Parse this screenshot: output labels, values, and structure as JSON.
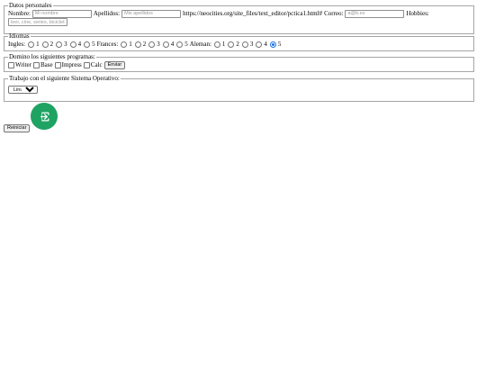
{
  "datos": {
    "legend": "Datos personales",
    "nombre_label": "Nombre:",
    "nombre_placeholder": "Mi nombre",
    "apellidos_label": "Apellidos:",
    "apellidos_placeholder": "Mis apellidos",
    "url_text": "https://neocities.org/site_files/text_editor/pctica1.html#",
    "correo_label": "Correo:",
    "correo_placeholder": "a@b.es",
    "hobbies_label": "Hobbies:",
    "hobbies_placeholder": "leer, cine, series, bicicleta"
  },
  "idiomas": {
    "legend": "Idiomas",
    "groups": [
      {
        "label": "Ingles:",
        "options": [
          "1",
          "2",
          "3",
          "4",
          "5"
        ],
        "selected": null
      },
      {
        "label": "Frances:",
        "options": [
          "1",
          "2",
          "3",
          "4",
          "5"
        ],
        "selected": null
      },
      {
        "label": "Aleman:",
        "options": [
          "1",
          "2",
          "3",
          "4",
          "5"
        ],
        "selected": "5"
      }
    ]
  },
  "programas": {
    "legend": "Domino los siguientes programas:",
    "items": [
      "Writer",
      "Base",
      "Impress",
      "Calc"
    ],
    "submit_label": "Enviar"
  },
  "sistema": {
    "legend": "Trabajo con el siguiente Sistema Operativo:",
    "selected": "Linux"
  },
  "reset_label": "Reiniciar",
  "colors": {
    "fab": "#1ea362",
    "radio_checked": "#1a73e8"
  }
}
